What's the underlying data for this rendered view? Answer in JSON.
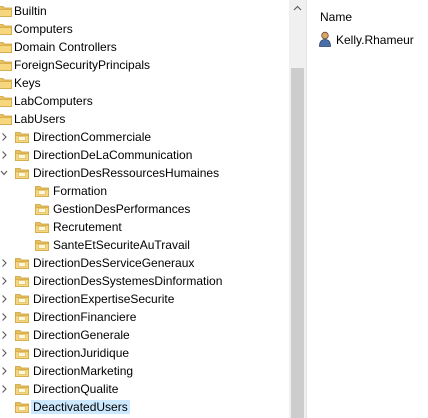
{
  "tree": {
    "items": [
      {
        "label": "Builtin"
      },
      {
        "label": "Computers"
      },
      {
        "label": "Domain Controllers"
      },
      {
        "label": "ForeignSecurityPrincipals"
      },
      {
        "label": "Keys"
      },
      {
        "label": "LabComputers"
      },
      {
        "label": "LabUsers"
      },
      {
        "label": "DirectionCommerciale"
      },
      {
        "label": "DirectionDeLaCommunication"
      },
      {
        "label": "DirectionDesRessourcesHumaines"
      },
      {
        "label": "Formation"
      },
      {
        "label": "GestionDesPerformances"
      },
      {
        "label": "Recrutement"
      },
      {
        "label": "SanteEtSecuriteAuTravail"
      },
      {
        "label": "DirectionDesServiceGeneraux"
      },
      {
        "label": "DirectionDesSystemesDinformation"
      },
      {
        "label": "DirectionExpertiseSecurite"
      },
      {
        "label": "DirectionFinanciere"
      },
      {
        "label": "DirectionGenerale"
      },
      {
        "label": "DirectionJuridique"
      },
      {
        "label": "DirectionMarketing"
      },
      {
        "label": "DirectionQualite"
      },
      {
        "label": "DeactivatedUsers"
      }
    ]
  },
  "list": {
    "column_header": "Name",
    "items": [
      {
        "label": "Kelly.Rhameur",
        "icon": "user-icon"
      }
    ]
  },
  "colors": {
    "folder": "#e8c15c",
    "folder_dark": "#c9a03a",
    "selection": "#cce8ff"
  }
}
